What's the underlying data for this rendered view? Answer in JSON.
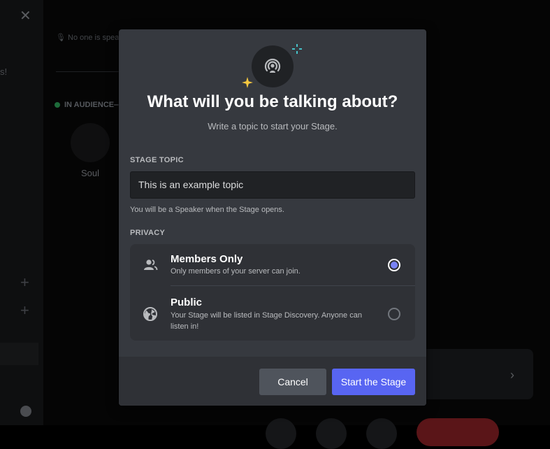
{
  "background": {
    "close_glyph": "✕",
    "partial_text": "s!",
    "no_one_speaking": "No one is spea",
    "audience_label": "IN AUDIENCE—",
    "audience_member": "Soul",
    "plus_glyph": "+",
    "chevron_glyph": "›"
  },
  "modal": {
    "title": "What will you be talking about?",
    "subtitle": "Write a topic to start your Stage.",
    "topic_label": "STAGE TOPIC",
    "topic_value": "This is an example topic",
    "topic_hint": "You will be a Speaker when the Stage opens.",
    "privacy_label": "PRIVACY",
    "options": [
      {
        "title": "Members Only",
        "description": "Only members of your server can join.",
        "icon": "members-icon",
        "selected": true
      },
      {
        "title": "Public",
        "description": "Your Stage will be listed in Stage Discovery. Anyone can listen in!",
        "icon": "globe-icon",
        "selected": false
      }
    ],
    "cancel_label": "Cancel",
    "start_label": "Start the Stage"
  },
  "colors": {
    "accent": "#5865f2",
    "radio_selected": "#7983f5",
    "modal_bg": "#36393f",
    "footer_bg": "#2f3136",
    "sparkle_yellow": "#f8c840",
    "sparkle_teal": "#45c2c9"
  }
}
